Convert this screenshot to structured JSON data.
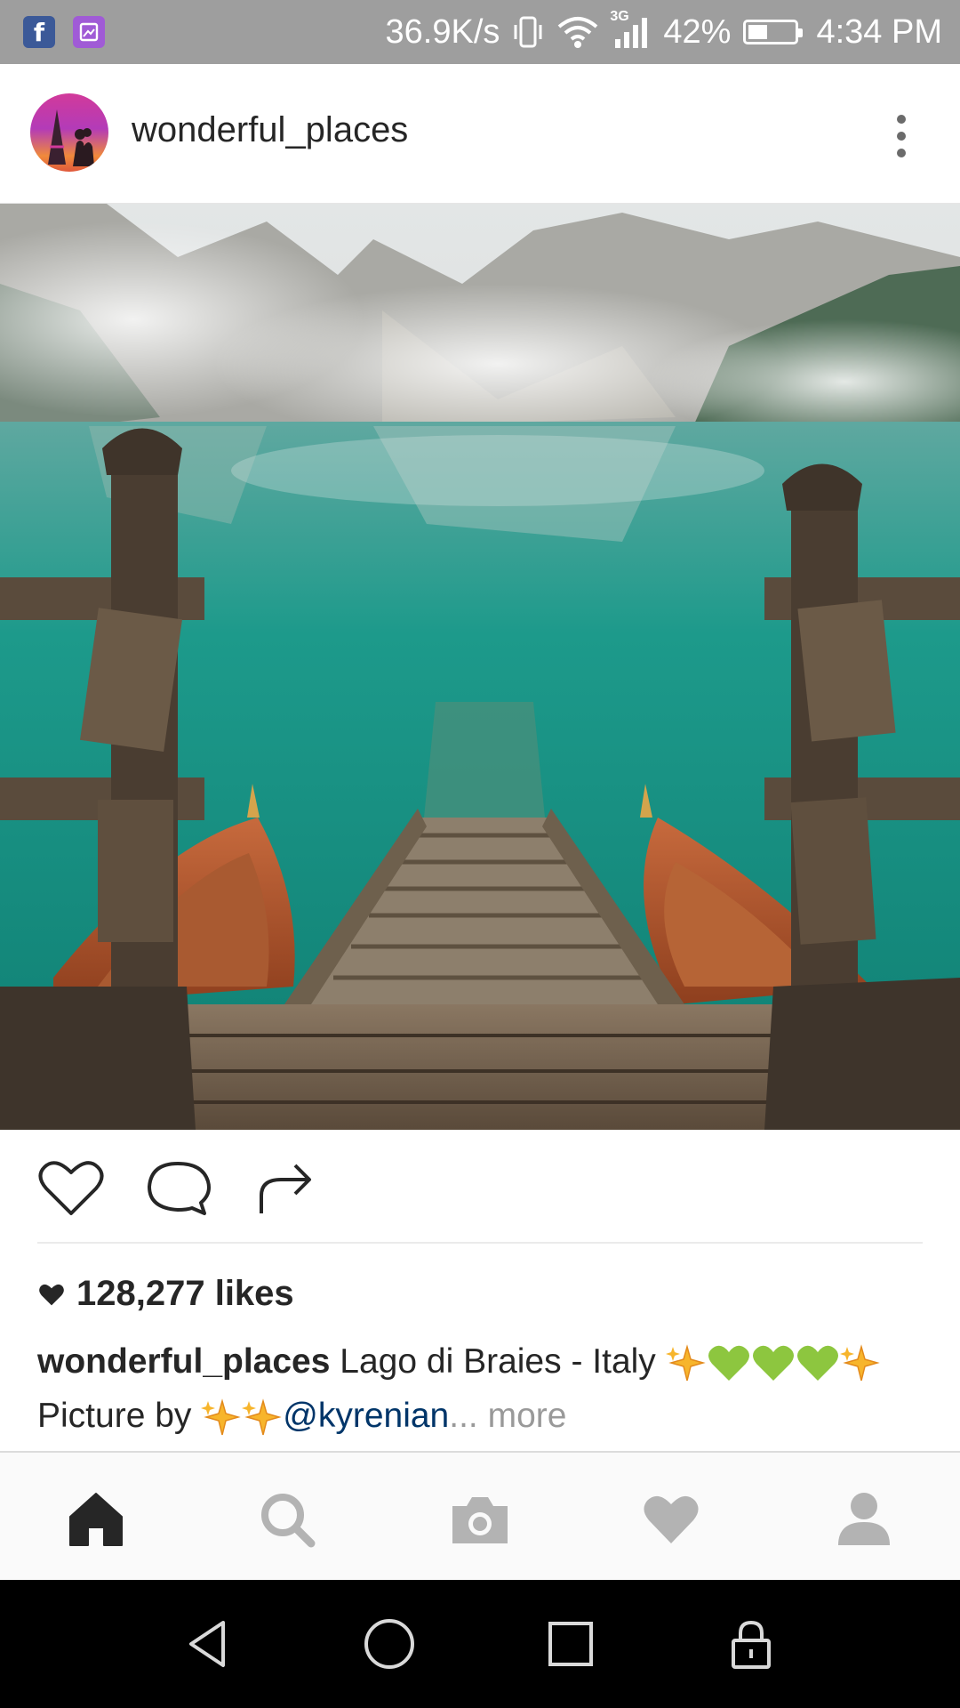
{
  "status_bar": {
    "net_speed": "36.9K/s",
    "network": "3G",
    "battery": "42%",
    "battery_level": 0.42,
    "time": "4:34 PM",
    "notification_icons": [
      "facebook-icon",
      "gallery-icon"
    ]
  },
  "post": {
    "username": "wonderful_places",
    "likes": "128,277 likes",
    "caption_user": "wonderful_places",
    "caption_text": "Lago di Braies - Italy",
    "caption_line2": "Picture by",
    "mention": "@kyrenian",
    "ellipsis": "...",
    "more": "more"
  },
  "colors": {
    "status_bar": "#9e9e9e",
    "text": "#262626",
    "mention": "#003569",
    "muted": "#999999",
    "lake": "#1fa394",
    "heart_green": "#8dc63f",
    "sparkle": "#f7b52c"
  },
  "icons": {
    "actions": [
      "heart-outline-icon",
      "comment-icon",
      "share-icon"
    ],
    "bottom_nav": [
      "home-icon",
      "search-icon",
      "camera-icon",
      "heart-icon",
      "profile-icon"
    ],
    "system_nav": [
      "back-icon",
      "home-circle-icon",
      "recents-icon",
      "lock-icon"
    ]
  }
}
